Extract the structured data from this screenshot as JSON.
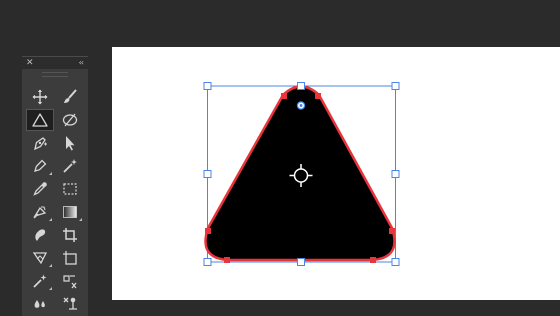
{
  "toolbar": {
    "close_glyph": "✕",
    "collapse_glyph": "‹‹",
    "tools": [
      {
        "name": "move-tool",
        "icon": "move-icon"
      },
      {
        "name": "paintbrush-tool",
        "icon": "paintbrush-icon"
      },
      {
        "name": "shape-tool",
        "icon": "triangle-icon",
        "selected": true
      },
      {
        "name": "blob-brush-tool",
        "icon": "blob-brush-icon"
      },
      {
        "name": "pen-tool",
        "icon": "pen-icon"
      },
      {
        "name": "selection-tool",
        "icon": "arrow-icon"
      },
      {
        "name": "pencil-tool",
        "icon": "pencil-icon"
      },
      {
        "name": "magic-wand-tool",
        "icon": "magic-wand-icon"
      },
      {
        "name": "eyedropper-tool",
        "icon": "eyedropper-icon"
      },
      {
        "name": "marquee-tool",
        "icon": "marquee-icon"
      },
      {
        "name": "live-paint-tool",
        "icon": "live-paint-icon"
      },
      {
        "name": "gradient-tool",
        "icon": "gradient-icon"
      },
      {
        "name": "eraser-tool",
        "icon": "eraser-icon"
      },
      {
        "name": "crop-tool",
        "icon": "crop-icon"
      },
      {
        "name": "puppet-warp-tool",
        "icon": "puppet-warp-icon"
      },
      {
        "name": "artboard-tool",
        "icon": "artboard-icon"
      },
      {
        "name": "spot-healing-tool",
        "icon": "spot-healing-icon"
      },
      {
        "name": "perspective-tool",
        "icon": "perspective-icon"
      },
      {
        "name": "blur-tool",
        "icon": "blur-icon"
      },
      {
        "name": "puppet-pin-tool",
        "icon": "puppet-pin-icon"
      }
    ]
  },
  "canvas": {
    "background": "#ffffff",
    "shape": {
      "fill": "#000000",
      "selection_stroke": "#e8343b",
      "bounding_box_color": "#4a86e8",
      "widget_color": "#ffffff"
    }
  }
}
